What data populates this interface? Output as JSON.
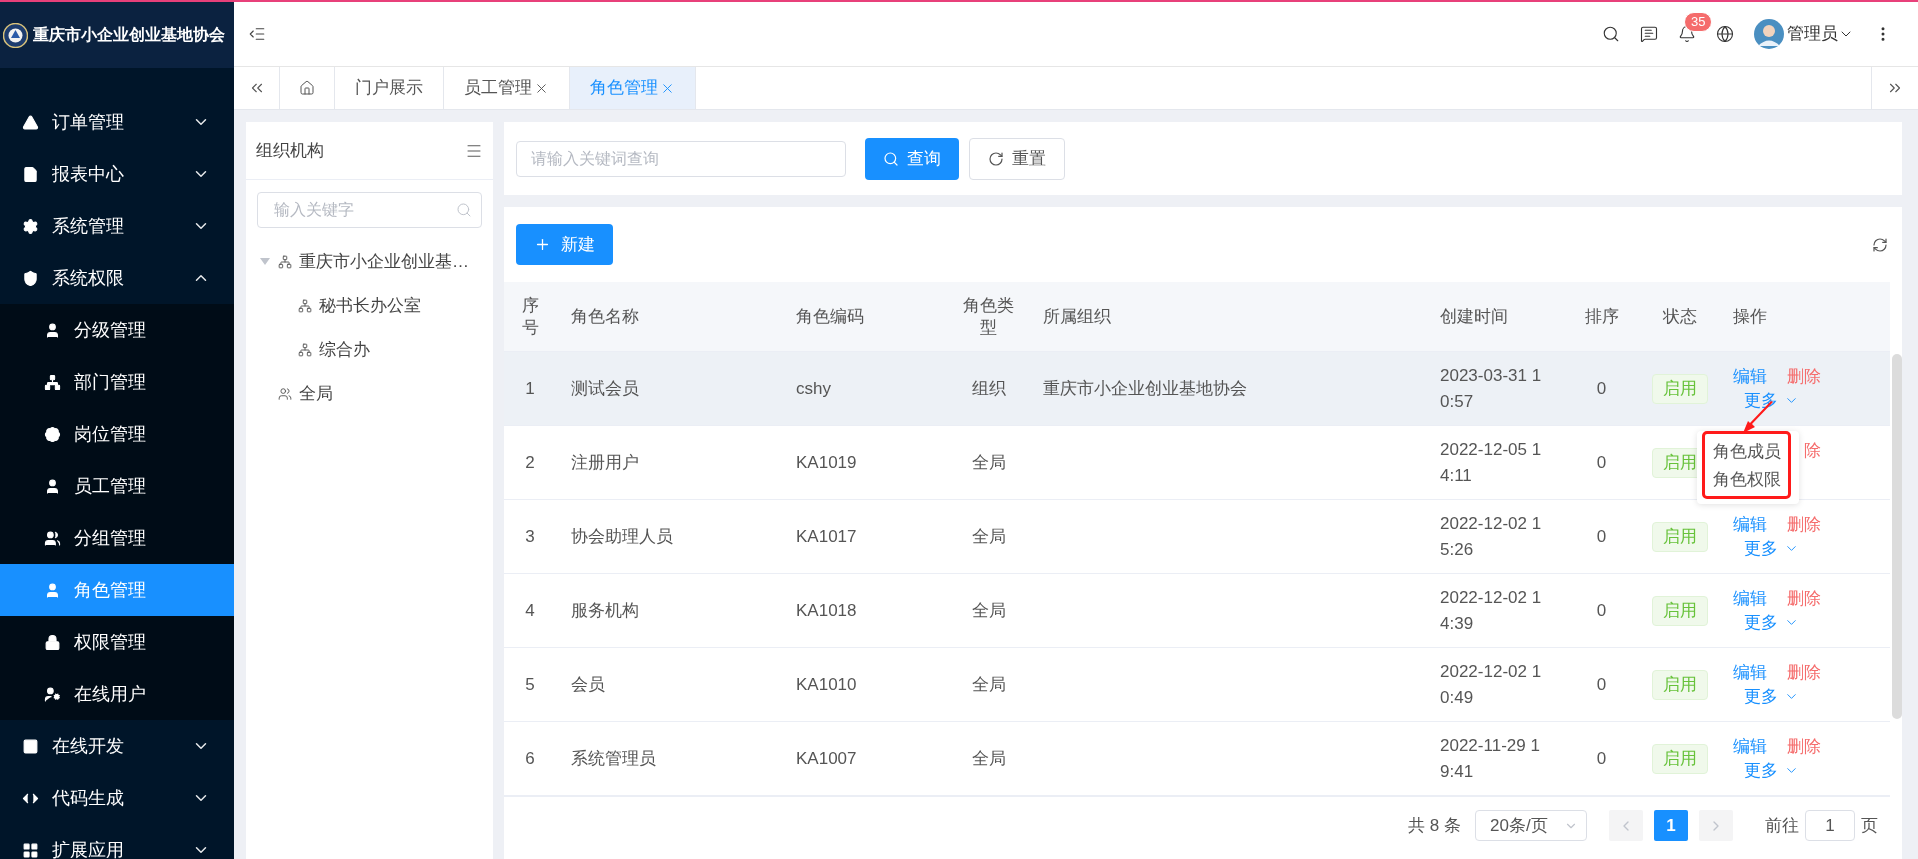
{
  "brand": {
    "title": "重庆市小企业创业基地协会"
  },
  "menu": [
    {
      "label": "订单管理",
      "expanded": false
    },
    {
      "label": "报表中心",
      "expanded": false
    },
    {
      "label": "系统管理",
      "expanded": false
    },
    {
      "label": "系统权限",
      "expanded": true,
      "children": [
        {
          "label": "分级管理",
          "selected": false
        },
        {
          "label": "部门管理",
          "selected": false
        },
        {
          "label": "岗位管理",
          "selected": false
        },
        {
          "label": "员工管理",
          "selected": false
        },
        {
          "label": "分组管理",
          "selected": false
        },
        {
          "label": "角色管理",
          "selected": true
        },
        {
          "label": "权限管理",
          "selected": false
        },
        {
          "label": "在线用户",
          "selected": false
        }
      ]
    },
    {
      "label": "在线开发",
      "expanded": false
    },
    {
      "label": "代码生成",
      "expanded": false
    },
    {
      "label": "扩展应用",
      "expanded": false
    }
  ],
  "header": {
    "notifications": "35",
    "user": "管理员"
  },
  "tabs": [
    {
      "kind": "home",
      "selected": false
    },
    {
      "kind": "page",
      "label": "门户展示",
      "closable": false,
      "selected": false
    },
    {
      "kind": "page",
      "label": "员工管理",
      "closable": true,
      "selected": false
    },
    {
      "kind": "page",
      "label": "角色管理",
      "closable": true,
      "selected": true
    }
  ],
  "org_panel": {
    "title": "组织机构",
    "search_placeholder": "输入关键字",
    "tree": [
      {
        "label": "重庆市小企业创业基…",
        "kind": "org",
        "expanded": true,
        "children": [
          {
            "label": "秘书长办公室",
            "kind": "org"
          },
          {
            "label": "综合办",
            "kind": "org"
          }
        ]
      },
      {
        "label": "全局",
        "kind": "group"
      }
    ]
  },
  "search": {
    "placeholder": "请输入关键词查询",
    "buttons": [
      {
        "kind": "primary",
        "label": "查询"
      },
      {
        "kind": "default",
        "label": "重置"
      }
    ]
  },
  "toolbar": {
    "new_label": "新建"
  },
  "table": {
    "columns": [
      "序号",
      "角色名称",
      "角色编码",
      "角色类型",
      "所属组织",
      "创建时间",
      "排序",
      "状态",
      "操作"
    ],
    "rows": [
      {
        "index": "1",
        "name": "测试会员",
        "code": "cshy",
        "type": "组织",
        "org": "重庆市小企业创业基地协会",
        "created": "2023-03-31 10:57",
        "order": "0",
        "status": "启用",
        "hovered": true,
        "actions": [
          {
            "kind": "edit",
            "label": "编辑"
          },
          {
            "kind": "delete",
            "label": "删除"
          },
          {
            "kind": "more",
            "label": "更多"
          }
        ],
        "menu": [
          "角色成员",
          "角色权限"
        ]
      },
      {
        "index": "2",
        "name": "注册用户",
        "code": "KA1019",
        "type": "全局",
        "created": "2022-12-05 14:11",
        "order": "0",
        "status": "启用",
        "hovered": false,
        "actions": [
          {
            "kind": "delete",
            "label": "除"
          }
        ]
      },
      {
        "index": "3",
        "name": "协会助理人员",
        "code": "KA1017",
        "type": "全局",
        "created": "2022-12-02 15:26",
        "order": "0",
        "status": "启用",
        "hovered": false,
        "actions": [
          {
            "kind": "edit",
            "label": "编辑"
          },
          {
            "kind": "delete",
            "label": "删除"
          },
          {
            "kind": "more",
            "label": "更多"
          }
        ]
      },
      {
        "index": "4",
        "name": "服务机构",
        "code": "KA1018",
        "type": "全局",
        "created": "2022-12-02 14:39",
        "order": "0",
        "status": "启用",
        "hovered": false,
        "actions": [
          {
            "kind": "edit",
            "label": "编辑"
          },
          {
            "kind": "delete",
            "label": "删除"
          },
          {
            "kind": "more",
            "label": "更多"
          }
        ]
      },
      {
        "index": "5",
        "name": "会员",
        "code": "KA1010",
        "type": "全局",
        "created": "2022-12-02 10:49",
        "order": "0",
        "status": "启用",
        "hovered": false,
        "actions": [
          {
            "kind": "edit",
            "label": "编辑"
          },
          {
            "kind": "delete",
            "label": "删除"
          },
          {
            "kind": "more",
            "label": "更多"
          }
        ]
      },
      {
        "index": "6",
        "name": "系统管理员",
        "code": "KA1007",
        "type": "全局",
        "created": "2022-11-29 19:41",
        "order": "0",
        "status": "启用",
        "hovered": false,
        "actions": [
          {
            "kind": "edit",
            "label": "编辑"
          },
          {
            "kind": "delete",
            "label": "删除"
          },
          {
            "kind": "more",
            "label": "更多"
          }
        ]
      }
    ]
  },
  "pagination": {
    "total": "共 8 条",
    "page_size": "20条/页",
    "pages": [
      {
        "label": "1",
        "selected": true
      }
    ],
    "goto_label": "前往",
    "goto_value": "1",
    "page_suffix": "页"
  }
}
